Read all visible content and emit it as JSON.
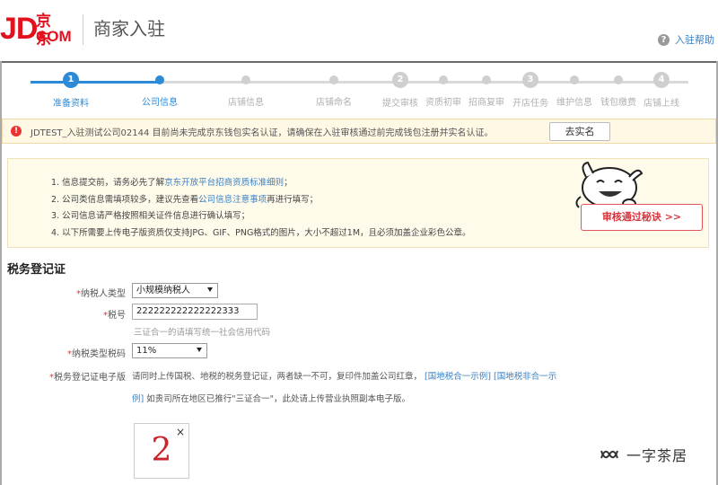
{
  "header": {
    "logo_jd": "JD.",
    "logo_cn": "京东",
    "logo_com": "COM",
    "title": "商家入驻",
    "help_label": "入驻帮助",
    "help_icon": "question-circle-icon"
  },
  "steps": [
    {
      "label": "准备资料",
      "number": "1",
      "kind": "big",
      "active": true
    },
    {
      "label": "公司信息",
      "number": "",
      "kind": "small",
      "active": true
    },
    {
      "label": "店铺信息",
      "number": "",
      "kind": "small",
      "active": false
    },
    {
      "label": "店铺命名",
      "number": "",
      "kind": "small",
      "active": false
    },
    {
      "label": "提交审核",
      "number": "2",
      "kind": "big",
      "active": false
    },
    {
      "label": "资质初审",
      "number": "",
      "kind": "small",
      "active": false
    },
    {
      "label": "招商复审",
      "number": "",
      "kind": "small",
      "active": false
    },
    {
      "label": "开店任务",
      "number": "3",
      "kind": "big",
      "active": false
    },
    {
      "label": "维护信息",
      "number": "",
      "kind": "small",
      "active": false
    },
    {
      "label": "钱包缴费",
      "number": "",
      "kind": "small",
      "active": false
    },
    {
      "label": "店铺上线",
      "number": "4",
      "kind": "big",
      "active": false
    }
  ],
  "warning": {
    "text": "JDTEST_入驻测试公司02144 目前尚未完成京东钱包实名认证，请确保在入驻审核通过前完成钱包注册并实名认证。",
    "button_label": "去实名"
  },
  "notice": {
    "item1_prefix": "1. 信息提交前，请务必先了解",
    "item1_link": "京东开放平台招商资质标准细则",
    "item1_suffix": "；",
    "item2_prefix": "2. 公司类信息需填项较多，建议先查看",
    "item2_link": "公司信息注意事项",
    "item2_suffix": "再进行填写；",
    "item3": "3. 公司信息请严格按照相关证件信息进行确认填写；",
    "item4": "4. 以下所需要上传电子版资质仅支持JPG、GIF、PNG格式的图片，大小不超过1M，且必须加盖企业彩色公章。",
    "tips_button": "审核通过秘诀 >>"
  },
  "form": {
    "section_title": "税务登记证",
    "taxpayer_type_label": "纳税人类型",
    "taxpayer_type_value": "小规模纳税人",
    "tax_number_label": "税号",
    "tax_number_value": "222222222222222333",
    "tax_number_hint": "三证合一的请填写统一社会信用代码",
    "tax_rate_label": "纳税类型税码",
    "tax_rate_value": "11%",
    "cert_label": "税务登记证电子版",
    "cert_desc1": "请同时上传国税、地税的税务登记证，两者缺一不可，复印件加盖公司红章，",
    "cert_link1": "国地税合一示例",
    "cert_link2_part1": "国地税非合一示",
    "cert_link2_part2": "例",
    "cert_desc2": "如贵司所在地区已推行\"三证合一\"，此处请上传营业执照副本电子版。",
    "upload_preview": "2",
    "upload_close": "×"
  },
  "watermark": {
    "text": "一字茶居",
    "icon": "wechat-channel-icon"
  },
  "colors": {
    "brand_red": "#e3101e",
    "accent_blue": "#2d8ad6",
    "link_blue": "#3a7fc4",
    "warning_bg": "#fff8e5",
    "notice_bg": "#fffbeb"
  }
}
